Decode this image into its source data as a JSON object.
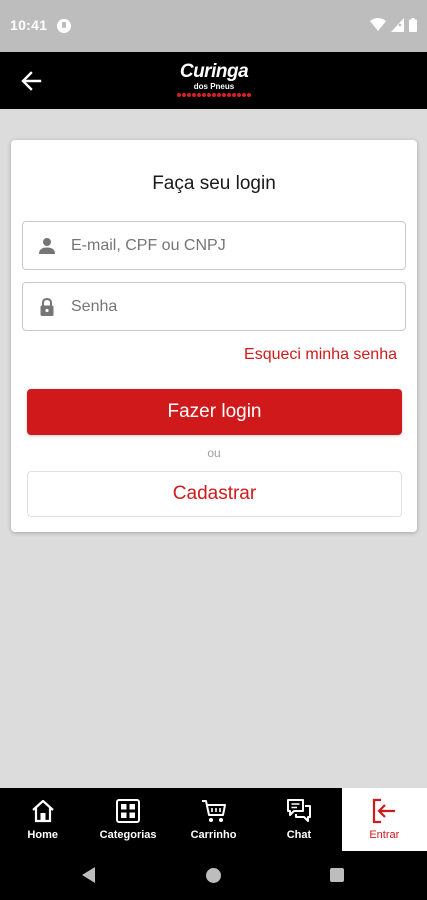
{
  "status_bar": {
    "time": "10:41"
  },
  "header": {
    "logo_main": "Curinga",
    "logo_sub": "dos Pneus"
  },
  "login": {
    "title": "Faça seu login",
    "email_placeholder": "E-mail, CPF ou CNPJ",
    "email_value": "",
    "password_placeholder": "Senha",
    "password_value": "",
    "forgot_label": "Esqueci minha senha",
    "login_button_label": "Fazer login",
    "or_label": "ou",
    "register_button_label": "Cadastrar"
  },
  "bottom_nav": {
    "items": [
      {
        "label": "Home",
        "icon": "home-icon"
      },
      {
        "label": "Categorias",
        "icon": "categories-icon"
      },
      {
        "label": "Carrinho",
        "icon": "cart-icon"
      },
      {
        "label": "Chat",
        "icon": "chat-icon"
      },
      {
        "label": "Entrar",
        "icon": "login-icon",
        "active": true
      }
    ]
  },
  "colors": {
    "brand_red": "#d0191b",
    "header_bg": "#000000",
    "page_bg": "#dcdcdc"
  }
}
